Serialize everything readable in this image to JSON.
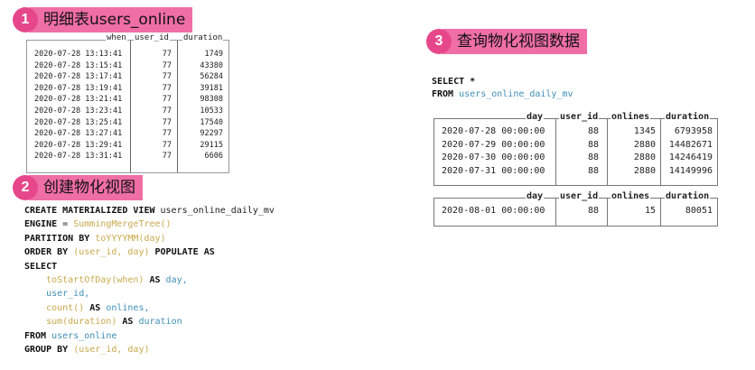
{
  "steps": {
    "s1": {
      "num": "1",
      "label": "明细表users_online"
    },
    "s2": {
      "num": "2",
      "label": "创建物化视图"
    },
    "s3": {
      "num": "3",
      "label": "查询物化视图数据"
    }
  },
  "users_online_table": {
    "columns": [
      "when",
      "user_id",
      "duration"
    ],
    "rows": [
      [
        "2020-07-28 13:13:41",
        "77",
        "1749"
      ],
      [
        "2020-07-28 13:15:41",
        "77",
        "43380"
      ],
      [
        "2020-07-28 13:17:41",
        "77",
        "56284"
      ],
      [
        "2020-07-28 13:19:41",
        "77",
        "39181"
      ],
      [
        "2020-07-28 13:21:41",
        "77",
        "98308"
      ],
      [
        "2020-07-28 13:23:41",
        "77",
        "10533"
      ],
      [
        "2020-07-28 13:25:41",
        "77",
        "17540"
      ],
      [
        "2020-07-28 13:27:41",
        "77",
        "92297"
      ],
      [
        "2020-07-28 13:29:41",
        "77",
        "29115"
      ],
      [
        "2020-07-28 13:31:41",
        "77",
        "6606"
      ]
    ]
  },
  "create_sql": {
    "l1_kw": "CREATE MATERIALIZED VIEW",
    "l1_name": " users_online_daily_mv",
    "l2_kw": "ENGINE",
    "l2_eq": " = ",
    "l2_fn": "SummingMergeTree()",
    "l3_kw": "PARTITION BY",
    "l3_fn": " toYYYYMM(day)",
    "l4_kw": "ORDER BY",
    "l4_fn": " (user_id, day)",
    "l4_kw2": " POPULATE AS",
    "l5_kw": "SELECT",
    "l6_fn": "    toStartOfDay(when)",
    "l6_kw": " AS ",
    "l6_id": "day,",
    "l7_id": "    user_id,",
    "l8_fn": "    count()",
    "l8_kw": " AS ",
    "l8_id": "onlines,",
    "l9_fn": "    sum(duration)",
    "l9_kw": " AS ",
    "l9_id": "duration",
    "l10_kw": "FROM",
    "l10_id": " users_online",
    "l11_kw": "GROUP BY",
    "l11_fn": " (user_id, day)"
  },
  "query_sql": {
    "l1": "SELECT *",
    "l2_kw": "FROM",
    "l2_id": " users_online_daily_mv"
  },
  "result_table_1": {
    "columns": [
      "day",
      "user_id",
      "onlines",
      "duration"
    ],
    "rows": [
      [
        "2020-07-28 00:00:00",
        "88",
        "1345",
        "6793958"
      ],
      [
        "2020-07-29 00:00:00",
        "88",
        "2880",
        "14482671"
      ],
      [
        "2020-07-30 00:00:00",
        "88",
        "2880",
        "14246419"
      ],
      [
        "2020-07-31 00:00:00",
        "88",
        "2880",
        "14149996"
      ]
    ]
  },
  "result_table_2": {
    "columns": [
      "day",
      "user_id",
      "onlines",
      "duration"
    ],
    "rows": [
      [
        "2020-08-01 00:00:00",
        "88",
        "15",
        "80051"
      ]
    ]
  }
}
